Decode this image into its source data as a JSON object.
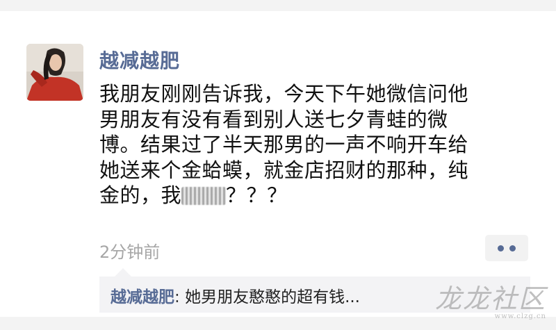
{
  "post": {
    "author": "越减越肥",
    "lines": [
      "我朋友刚刚告诉我，今天下午她微信问他",
      "男朋友有没有看到别人送七夕青蛙的微",
      "博。结果过了半天那男的一声不响开车给",
      "她送来个金蛤蟆，就金店招财的那种，纯"
    ],
    "last_line_before": "金的，我",
    "last_line_after": "？？？",
    "timestamp": "2分钟前"
  },
  "comment": {
    "author": "越减越肥",
    "separator": ": ",
    "text": "她男朋友憨憨的超有钱..."
  },
  "watermark": {
    "main": "龙龙社区",
    "url": "www.clzg.cn"
  },
  "colors": {
    "link_blue": "#576b95",
    "timestamp_gray": "#a6a6a6"
  },
  "icons": {
    "more": "two-dots-icon"
  }
}
